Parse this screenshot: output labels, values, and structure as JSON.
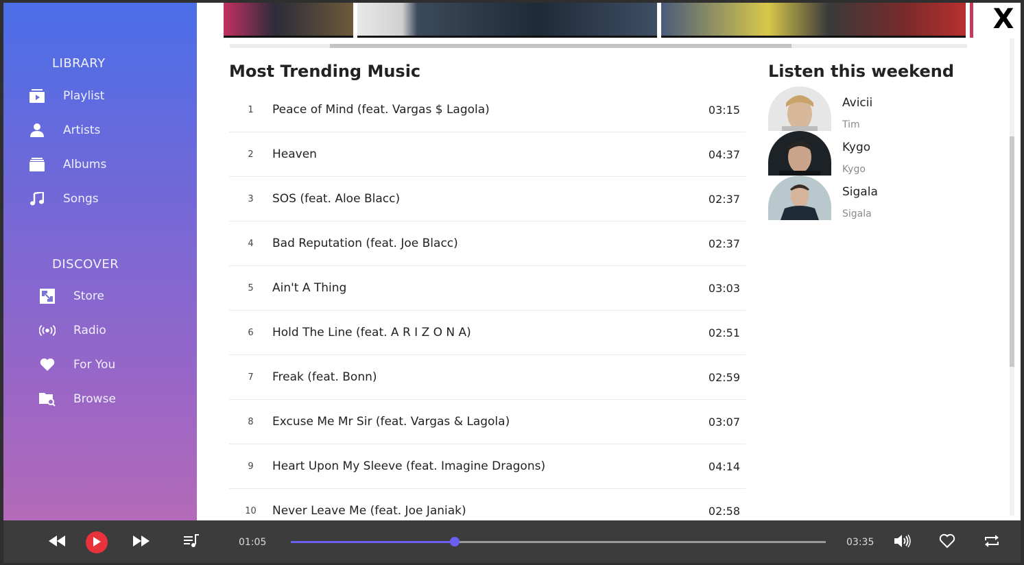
{
  "window": {
    "close_label": "X"
  },
  "sidebar": {
    "library_title": "LIBRARY",
    "library_items": [
      {
        "label": "Playlist",
        "icon": "playlist-icon"
      },
      {
        "label": "Artists",
        "icon": "person-icon"
      },
      {
        "label": "Albums",
        "icon": "albums-icon"
      },
      {
        "label": "Songs",
        "icon": "music-note-icon"
      }
    ],
    "discover_title": "DISCOVER",
    "discover_items": [
      {
        "label": "Store",
        "icon": "store-icon"
      },
      {
        "label": "Radio",
        "icon": "radio-icon"
      },
      {
        "label": "For You",
        "icon": "heart-icon"
      },
      {
        "label": "Browse",
        "icon": "browse-icon"
      }
    ]
  },
  "trending": {
    "title": "Most Trending Music",
    "tracks": [
      {
        "num": "1",
        "title": "Peace of Mind (feat. Vargas $ Lagola)",
        "duration": "03:15"
      },
      {
        "num": "2",
        "title": "Heaven",
        "duration": "04:37"
      },
      {
        "num": "3",
        "title": "SOS (feat. Aloe Blacc)",
        "duration": "02:37"
      },
      {
        "num": "4",
        "title": "Bad Reputation (feat. Joe Blacc)",
        "duration": "02:37"
      },
      {
        "num": "5",
        "title": "Ain't A Thing",
        "duration": "03:03"
      },
      {
        "num": "6",
        "title": "Hold The Line (feat. A R I Z O N A)",
        "duration": "02:51"
      },
      {
        "num": "7",
        "title": "Freak (feat. Bonn)",
        "duration": "02:59"
      },
      {
        "num": "8",
        "title": "Excuse Me Mr Sir (feat. Vargas & Lagola)",
        "duration": "03:07"
      },
      {
        "num": "9",
        "title": "Heart Upon My Sleeve (feat. Imagine Dragons)",
        "duration": "04:14"
      },
      {
        "num": "10",
        "title": "Never Leave Me (feat. Joe Janiak)",
        "duration": "02:58"
      }
    ]
  },
  "weekend": {
    "title": "Listen this weekend",
    "artists": [
      {
        "name": "Avicii",
        "sub": "Tim"
      },
      {
        "name": "Kygo",
        "sub": "Kygo"
      },
      {
        "name": "Sigala",
        "sub": "Sigala"
      }
    ]
  },
  "player": {
    "current_time": "01:05",
    "total_time": "03:35",
    "progress_fraction": 0.306
  },
  "colors": {
    "accent": "#6a5ff0",
    "play": "#e8323c",
    "sidebar_top": "#4a6ee8",
    "sidebar_bottom": "#b46ab8"
  }
}
